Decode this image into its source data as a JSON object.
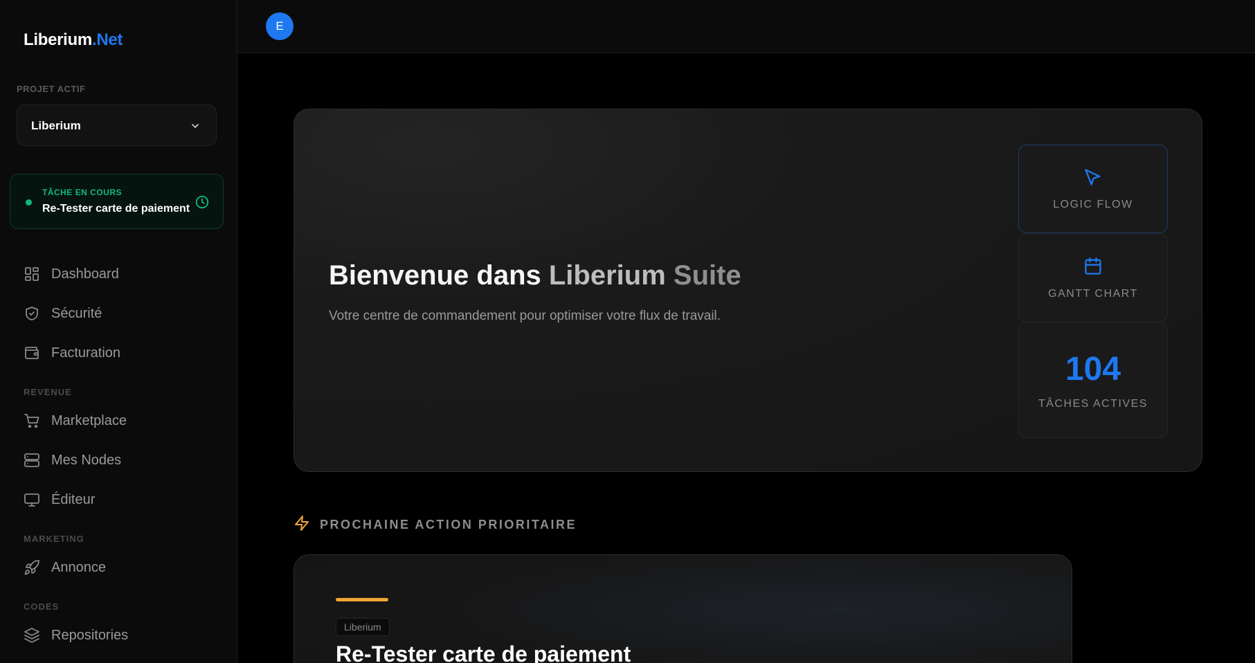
{
  "sidebar": {
    "logo_main": "Liberium",
    "logo_accent": ".Net",
    "project_label": "PROJET ACTIF",
    "project_value": "Liberium",
    "current_task": {
      "label": "TÂCHE EN COURS",
      "name": "Re-Tester carte de paiement"
    },
    "nav_main": [
      {
        "label": "Dashboard",
        "icon": "dashboard-icon"
      },
      {
        "label": "Sécurité",
        "icon": "shield-icon"
      },
      {
        "label": "Facturation",
        "icon": "wallet-icon"
      }
    ],
    "section_revenue": "REVENUE",
    "nav_revenue": [
      {
        "label": "Marketplace",
        "icon": "cart-icon"
      },
      {
        "label": "Mes Nodes",
        "icon": "server-icon"
      },
      {
        "label": "Éditeur",
        "icon": "monitor-icon"
      }
    ],
    "section_marketing": "MARKETING",
    "nav_marketing": [
      {
        "label": "Annonce",
        "icon": "rocket-icon"
      }
    ],
    "section_codes": "CODES",
    "nav_codes": [
      {
        "label": "Repositories",
        "icon": "layers-icon"
      }
    ]
  },
  "topbar": {
    "avatar_letter": "E"
  },
  "hero": {
    "title_part1": "Bienvenue dans ",
    "title_part2": "Liberium",
    "title_part3": " Suite",
    "subtitle": "Votre centre de commandement pour optimiser votre flux de travail.",
    "tiles": {
      "logic_flow": "LOGIC FLOW",
      "gantt": "GANTT CHART",
      "active_count": "104",
      "active_label": "TÂCHES ACTIVES"
    }
  },
  "next_action": {
    "heading": "PROCHAINE ACTION PRIORITAIRE",
    "tag": "Liberium",
    "title": "Re-Tester carte de paiement"
  },
  "colors": {
    "accent": "#1e78f0",
    "success": "#10b981",
    "warning": "#f0a533"
  }
}
